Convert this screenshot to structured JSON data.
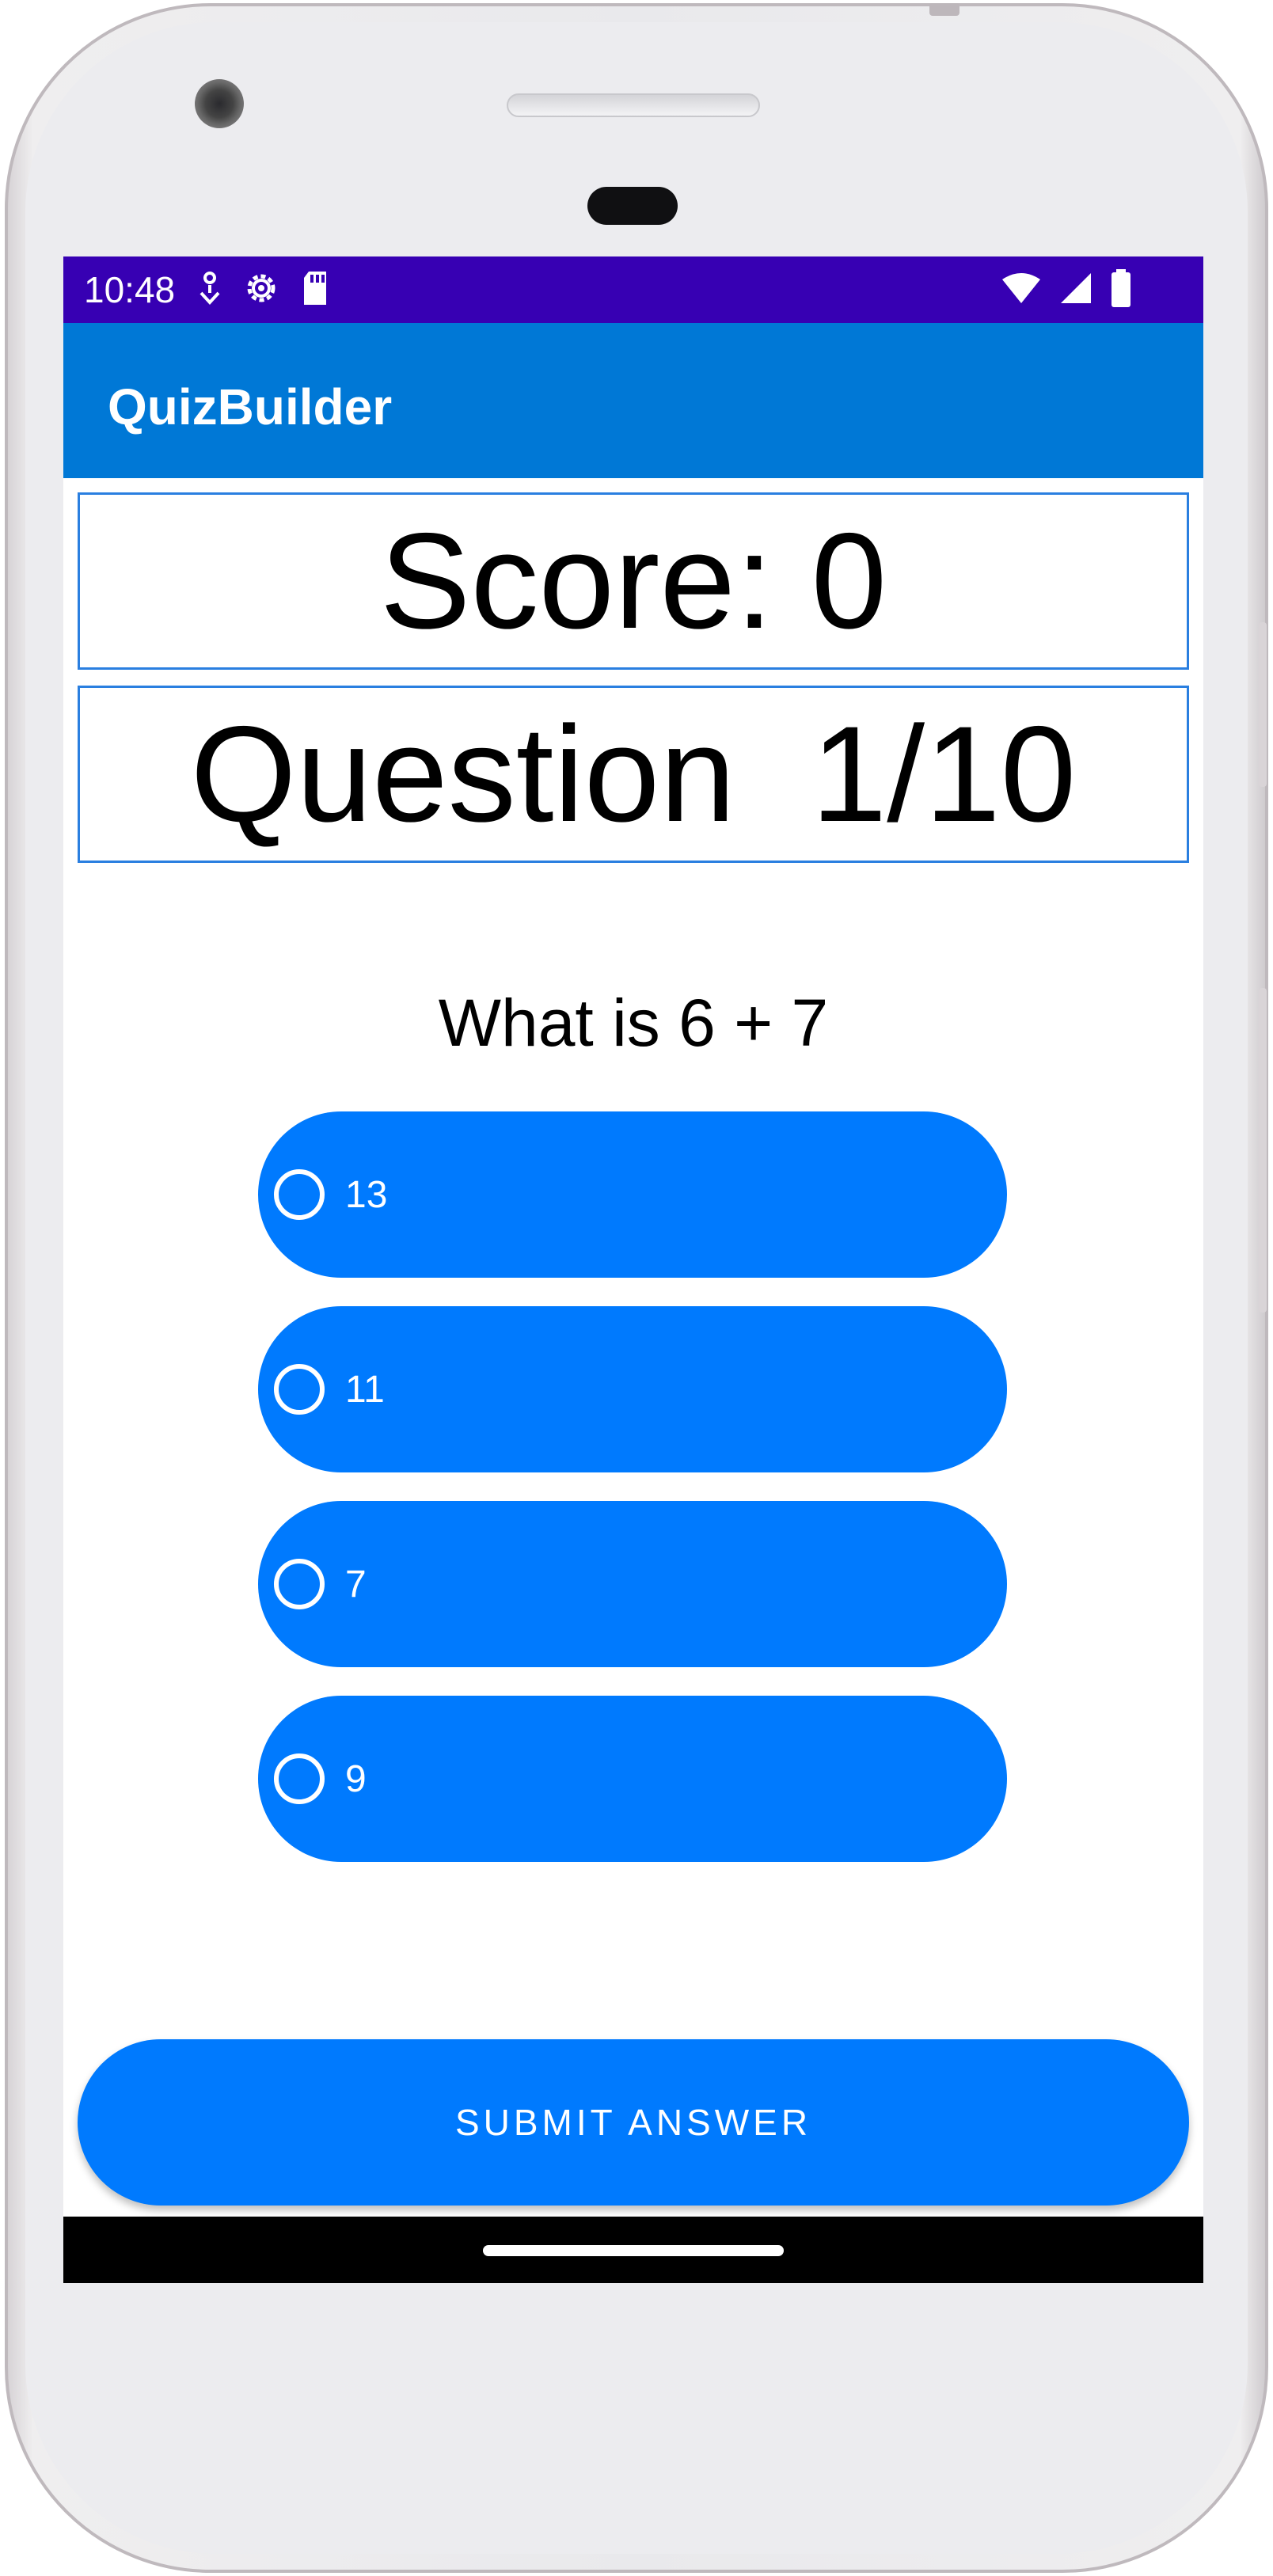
{
  "status_bar": {
    "time": "10:48",
    "left_icons": [
      "location-icon",
      "settings-icon",
      "sd-card-icon"
    ],
    "right_icons": [
      "wifi-icon",
      "cell-signal-icon",
      "battery-icon"
    ]
  },
  "app_bar": {
    "title": "QuizBuilder"
  },
  "score": {
    "label": "Score: 0"
  },
  "progress": {
    "label": "Question  1/10"
  },
  "question": {
    "text": "What is 6 + 7"
  },
  "options": [
    {
      "label": "13"
    },
    {
      "label": "11"
    },
    {
      "label": "7"
    },
    {
      "label": "9"
    }
  ],
  "submit": {
    "label": "SUBMIT ANSWER"
  },
  "colors": {
    "status_bar": "#3700b3",
    "app_bar": "#0078d6",
    "button": "#007afe",
    "box_border": "#2a7fe0"
  }
}
